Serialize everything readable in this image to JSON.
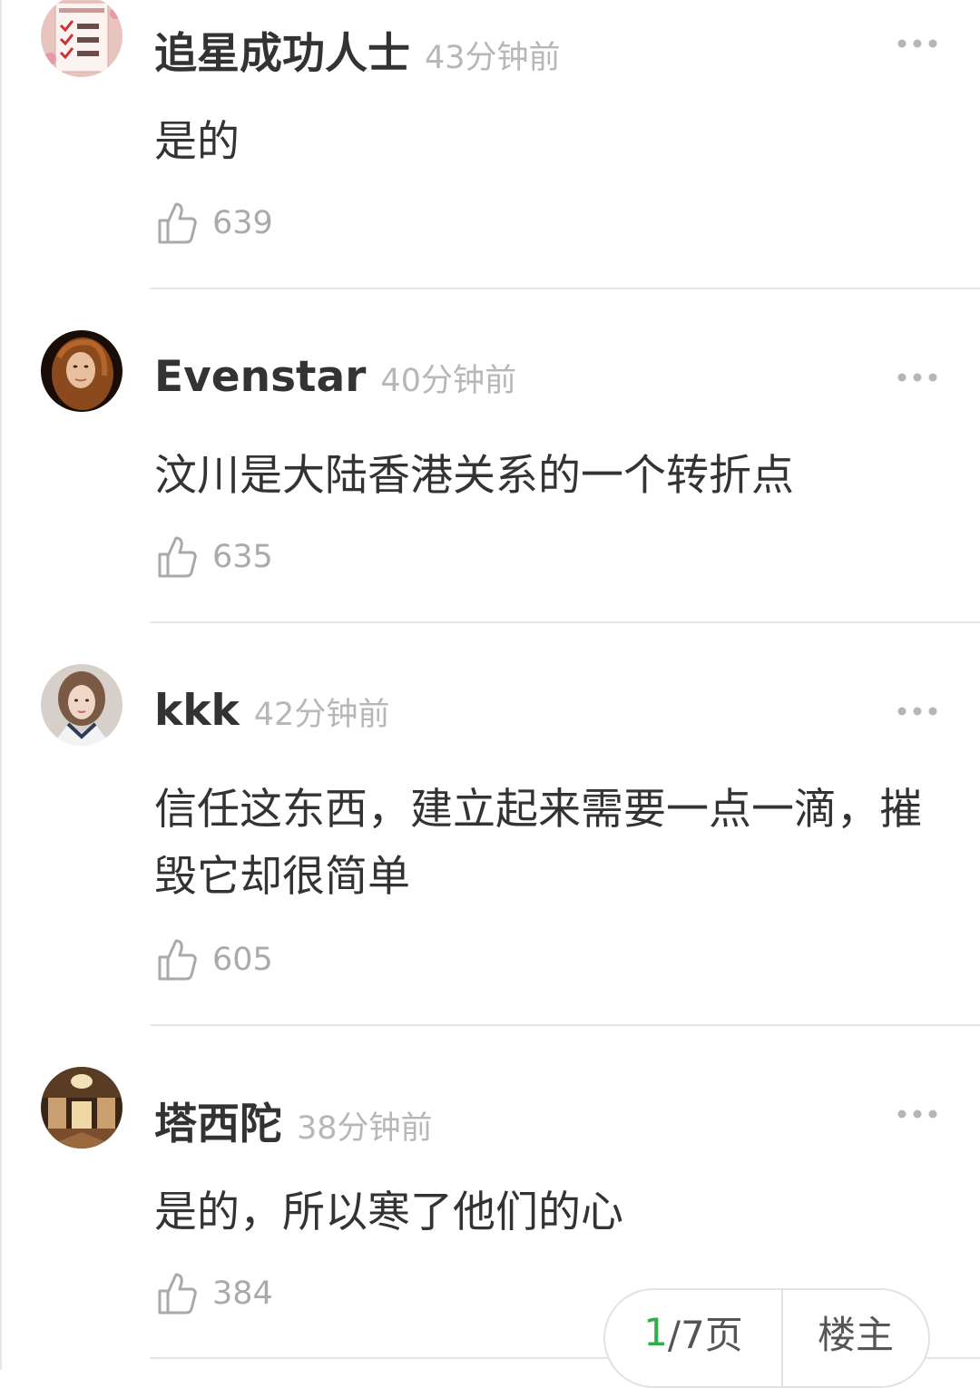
{
  "comments": [
    {
      "username": "追星成功人士",
      "time": "43分钟前",
      "text": "是的",
      "likes": "639",
      "avatar": "checklist-avatar"
    },
    {
      "username": "Evenstar",
      "time": "40分钟前",
      "text": "汶川是大陆香港关系的一个转折点",
      "likes": "635",
      "avatar": "portrait-avatar"
    },
    {
      "username": "kkk",
      "time": "42分钟前",
      "text": "信任这东西，建立起来需要一点一滴，摧毁它却很简单",
      "likes": "605",
      "avatar": "girl-portrait-avatar"
    },
    {
      "username": "塔西陀",
      "time": "38分钟前",
      "text": "是的，所以寒了他们的心",
      "likes": "384",
      "avatar": "interior-room-avatar"
    }
  ],
  "pager": {
    "current": "1",
    "rest": "/7页",
    "op_label": "楼主"
  },
  "icons": {
    "like": "thumbs-up-icon",
    "more": "more-dots-icon"
  }
}
